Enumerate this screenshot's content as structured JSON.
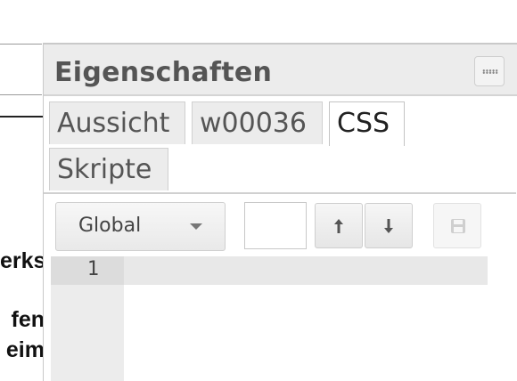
{
  "background_page": {
    "text_lines": [
      "erks",
      "fen",
      "eim"
    ]
  },
  "panel": {
    "title": "Eigenschaften",
    "menu_icon": "dots-grid-icon"
  },
  "tabs": [
    {
      "label": "Aussicht",
      "active": false
    },
    {
      "label": "w00036",
      "active": false
    },
    {
      "label": "CSS",
      "active": true
    },
    {
      "label": "Skripte",
      "active": false
    }
  ],
  "toolbar": {
    "scope_select": {
      "value": "Global"
    },
    "text_input": {
      "value": ""
    },
    "move_up_icon": "arrow-up-icon",
    "move_down_icon": "arrow-down-icon",
    "save_icon": "save-icon",
    "save_enabled": false
  },
  "editor": {
    "line_numbers": [
      "1"
    ],
    "content": ""
  },
  "colors": {
    "panel_header_bg": "#ececec",
    "tab_bg": "#ececec",
    "active_tab_bg": "#ffffff",
    "title_text": "#555555"
  }
}
